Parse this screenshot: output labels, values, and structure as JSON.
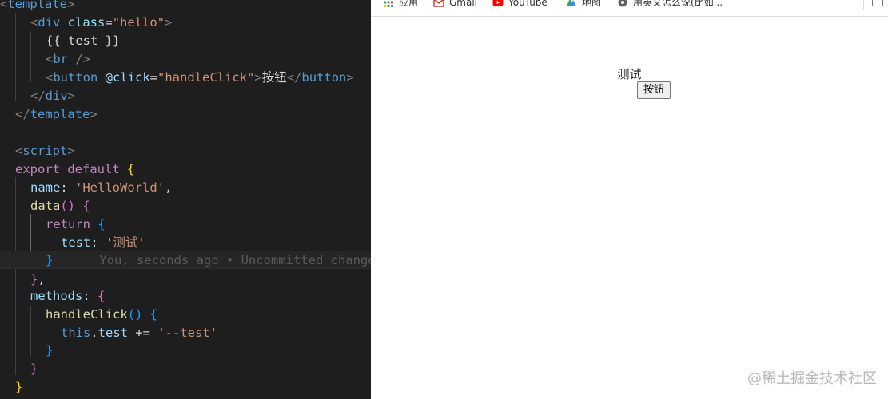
{
  "editor": {
    "lines": {
      "l1": {
        "tag_open": "<",
        "tag": "template",
        "tag_close": ">"
      },
      "l2": {
        "open": "<",
        "tag": "div",
        "attr": " class",
        "eq": "=",
        "val": "\"hello\"",
        "close": ">"
      },
      "l3": {
        "text": "{{ test }}"
      },
      "l4": {
        "open": "<",
        "tag": "br",
        "close": " />"
      },
      "l5": {
        "open": "<",
        "tag": "button",
        "attr": " @click",
        "eq": "=",
        "val": "\"handleClick\"",
        "close": ">",
        "text": "按钮",
        "end_open": "</",
        "end_tag": "button",
        "end_close": ">"
      },
      "l6": {
        "open": "</",
        "tag": "div",
        "close": ">"
      },
      "l7": {
        "open": "</",
        "tag": "template",
        "close": ">"
      },
      "l9": {
        "open": "<",
        "tag": "script",
        "close": ">"
      },
      "l10": {
        "kw1": "export",
        "kw2": " default",
        "brace": " {"
      },
      "l11": {
        "key": "name",
        "colon": ": ",
        "val": "'HelloWorld'",
        "comma": ","
      },
      "l12": {
        "fn": "data",
        "paren": "()",
        "brace": " {"
      },
      "l13": {
        "kw": "return",
        "brace": " {"
      },
      "l14": {
        "key": "test",
        "colon": ": ",
        "val": "'测试'"
      },
      "l15": {
        "brace": "}",
        "blame": "You, seconds ago • Uncommitted changes"
      },
      "l16": {
        "brace": "}",
        "comma": ","
      },
      "l17": {
        "key": "methods",
        "colon": ": ",
        "brace": "{"
      },
      "l18": {
        "fn": "handleClick",
        "paren": "()",
        "brace": " {"
      },
      "l19": {
        "this": "this",
        "dot": ".",
        "prop": "test",
        "op": " += ",
        "val": "'--test'"
      },
      "l20": {
        "brace": "}"
      },
      "l21": {
        "brace": "}"
      },
      "l22": {
        "brace": "}"
      }
    }
  },
  "browser": {
    "bookmarks": [
      {
        "label": "应用",
        "icon": "apps-grid-icon"
      },
      {
        "label": "Gmail",
        "icon": "gmail-icon"
      },
      {
        "label": "YouTube",
        "icon": "youtube-icon"
      },
      {
        "label": "地图",
        "icon": "maps-icon"
      },
      {
        "label": "用英文怎么说(比如...",
        "icon": "globe-icon"
      }
    ],
    "demo_text": "测试",
    "demo_button": "按钮",
    "watermark": "@稀土掘金技术社区"
  },
  "colors": {
    "editor_bg": "#1e1e1e",
    "tag": "#569cd6",
    "string": "#ce9178",
    "keyword": "#c586c0",
    "attr": "#9cdcfe",
    "function": "#dcdcaa"
  }
}
